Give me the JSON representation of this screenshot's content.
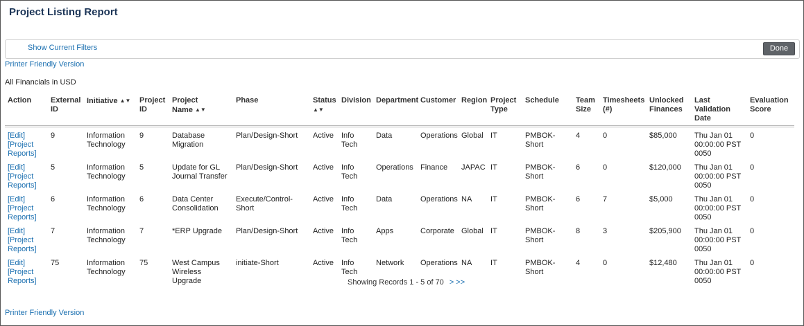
{
  "page": {
    "title": "Project Listing Report",
    "show_filters_label": "Show Current Filters",
    "done_label": "Done",
    "printer_friendly_label": "Printer Friendly Version",
    "financials_note": "All Financials in USD"
  },
  "table": {
    "columns": [
      "Action",
      "External ID",
      "Initiative",
      "Project ID",
      "Project Name",
      "Phase",
      "Status",
      "Division",
      "Department",
      "Customer",
      "Region",
      "Project Type",
      "Schedule",
      "Team Size",
      "Timesheets (#)",
      "Unlocked Finances",
      "Last Validation Date",
      "Evaluation Score"
    ],
    "sort_icon": "sort-updown-icon",
    "action_labels": {
      "edit": "[Edit]",
      "reports": "[Project Reports]"
    },
    "rows": [
      {
        "external_id": "9",
        "initiative": "Information Technology",
        "project_id": "9",
        "project_name": "Database Migration",
        "phase": "Plan/Design-Short",
        "status": "Active",
        "division": "Info Tech",
        "department": "Data",
        "customer": "Operations",
        "region": "Global",
        "project_type": "IT",
        "schedule": "PMBOK-Short",
        "team_size": "4",
        "timesheets": "0",
        "unlocked_finances": "$85,000",
        "last_validation": "Thu Jan 01 00:00:00 PST 0050",
        "evaluation_score": "0"
      },
      {
        "external_id": "5",
        "initiative": "Information Technology",
        "project_id": "5",
        "project_name": "Update for GL Journal Transfer",
        "phase": "Plan/Design-Short",
        "status": "Active",
        "division": "Info Tech",
        "department": "Operations",
        "customer": "Finance",
        "region": "JAPAC",
        "project_type": "IT",
        "schedule": "PMBOK-Short",
        "team_size": "6",
        "timesheets": "0",
        "unlocked_finances": "$120,000",
        "last_validation": "Thu Jan 01 00:00:00 PST 0050",
        "evaluation_score": "0"
      },
      {
        "external_id": "6",
        "initiative": "Information Technology",
        "project_id": "6",
        "project_name": "Data Center Consolidation",
        "phase": "Execute/Control-Short",
        "status": "Active",
        "division": "Info Tech",
        "department": "Data",
        "customer": "Operations",
        "region": "NA",
        "project_type": "IT",
        "schedule": "PMBOK-Short",
        "team_size": "6",
        "timesheets": "7",
        "unlocked_finances": "$5,000",
        "last_validation": "Thu Jan 01 00:00:00 PST 0050",
        "evaluation_score": "0"
      },
      {
        "external_id": "7",
        "initiative": "Information Technology",
        "project_id": "7",
        "project_name": "*ERP Upgrade",
        "phase": "Plan/Design-Short",
        "status": "Active",
        "division": "Info Tech",
        "department": "Apps",
        "customer": "Corporate",
        "region": "Global",
        "project_type": "IT",
        "schedule": "PMBOK-Short",
        "team_size": "8",
        "timesheets": "3",
        "unlocked_finances": "$205,900",
        "last_validation": "Thu Jan 01 00:00:00 PST 0050",
        "evaluation_score": "0"
      },
      {
        "external_id": "75",
        "initiative": "Information Technology",
        "project_id": "75",
        "project_name": "West Campus Wireless Upgrade",
        "phase": "initiate-Short",
        "status": "Active",
        "division": "Info Tech",
        "department": "Network",
        "customer": "Operations",
        "region": "NA",
        "project_type": "IT",
        "schedule": "PMBOK-Short",
        "team_size": "4",
        "timesheets": "0",
        "unlocked_finances": "$12,480",
        "last_validation": "Thu Jan 01 00:00:00 PST 0050",
        "evaluation_score": "0"
      }
    ]
  },
  "pagination": {
    "summary": "Showing Records 1 - 5 of 70",
    "next_label": "> >>"
  }
}
